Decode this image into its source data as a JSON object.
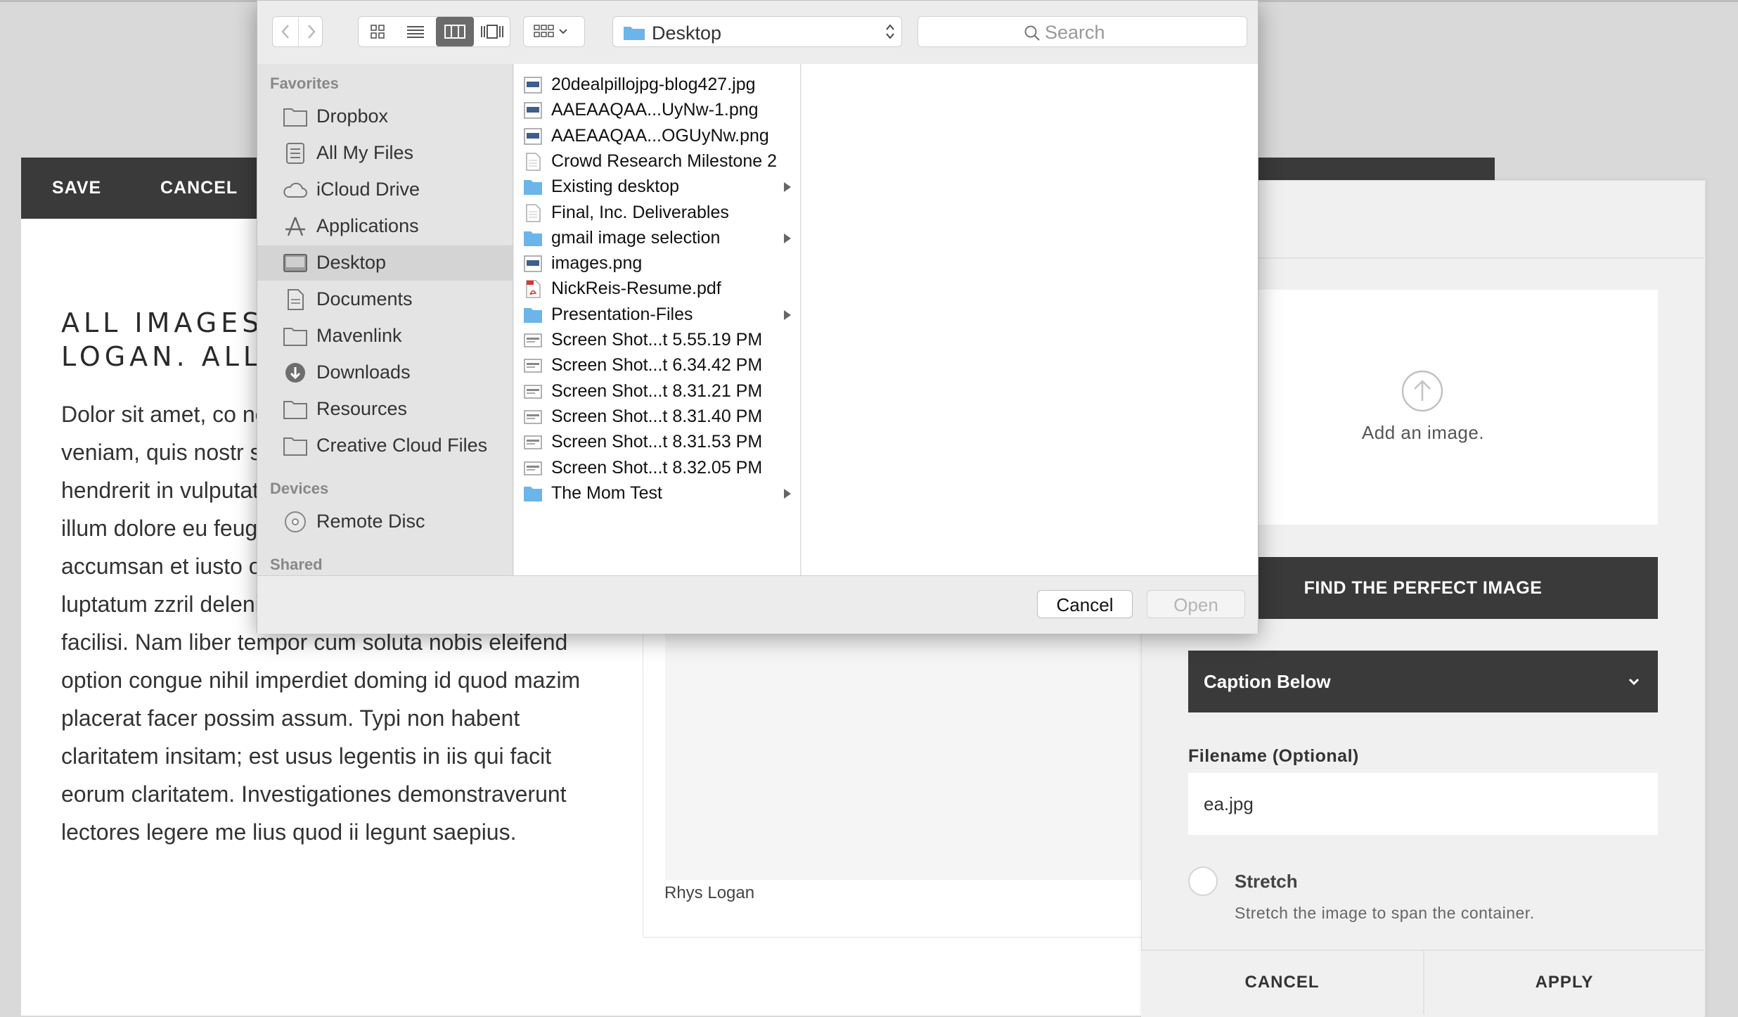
{
  "editor": {
    "save_label": "SAVE",
    "cancel_label": "CANCEL",
    "heading": "ALL IMAGES\nLOGAN. ALL",
    "body": "Dolor sit amet, co nonummy nibh eu magna aliquam er veniam, quis nostr suscipit lobortis n consequat. Duis a hendrerit in vulputate velit esse molestie consequat, vel illum dolore eu feugiat nulla facilisis at vero eros et accumsan et iusto odio dignissim qui blandit praesent luptatum zzril delenit augue duis dolore te feugait nulla facilisi. Nam liber tempor cum soluta nobis eleifend option congue nihil imperdiet doming id quod mazim placerat facer possim assum. Typi non habent claritatem insitam; est usus legentis in iis qui facit eorum claritatem. Investigationes demonstraverunt lectores legere me lius quod ii legunt saepius.",
    "image_caption": "Rhys Logan"
  },
  "panel": {
    "dropzone_text": "Add an image.",
    "dropzone_icon": "upload-arrow-icon",
    "find_button": "FIND THE PERFECT IMAGE",
    "caption_value": "Caption Below",
    "filename_label": "Filename (Optional)",
    "filename_value": "ea.jpg",
    "stretch_label": "Stretch",
    "stretch_desc": "Stretch the image to span the container.",
    "cancel_label": "CANCEL",
    "apply_label": "APPLY"
  },
  "dialog": {
    "location": "Desktop",
    "search_placeholder": "Search",
    "sidebar_sections": {
      "favorites": "Favorites",
      "devices": "Devices",
      "shared": "Shared"
    },
    "favorites": [
      {
        "label": "Dropbox",
        "icon": "folder-icon"
      },
      {
        "label": "All My Files",
        "icon": "all-files-icon"
      },
      {
        "label": "iCloud Drive",
        "icon": "cloud-icon"
      },
      {
        "label": "Applications",
        "icon": "applications-icon"
      },
      {
        "label": "Desktop",
        "icon": "desktop-icon",
        "selected": true
      },
      {
        "label": "Documents",
        "icon": "documents-icon"
      },
      {
        "label": "Mavenlink",
        "icon": "folder-icon"
      },
      {
        "label": "Downloads",
        "icon": "downloads-icon"
      },
      {
        "label": "Resources",
        "icon": "folder-icon"
      },
      {
        "label": "Creative Cloud Files",
        "icon": "folder-icon"
      }
    ],
    "devices": [
      {
        "label": "Remote Disc",
        "icon": "disc-icon"
      }
    ],
    "files": [
      {
        "name": "20dealpillojpg-blog427.jpg",
        "kind": "image",
        "folder": false
      },
      {
        "name": "AAEAAQAA...UyNw-1.png",
        "kind": "image",
        "folder": false
      },
      {
        "name": "AAEAAQAA...OGUyNw.png",
        "kind": "image",
        "folder": false
      },
      {
        "name": "Crowd Research Milestone 2",
        "kind": "document",
        "folder": false
      },
      {
        "name": "Existing desktop",
        "kind": "folder",
        "folder": true
      },
      {
        "name": "Final, Inc. Deliverables",
        "kind": "document",
        "folder": false
      },
      {
        "name": "gmail image selection",
        "kind": "folder",
        "folder": true
      },
      {
        "name": "images.png",
        "kind": "image",
        "folder": false
      },
      {
        "name": "NickReis-Resume.pdf",
        "kind": "pdf",
        "folder": false
      },
      {
        "name": "Presentation-Files",
        "kind": "folder",
        "folder": true
      },
      {
        "name": "Screen Shot...t 5.55.19 PM",
        "kind": "screenshot",
        "folder": false
      },
      {
        "name": "Screen Shot...t 6.34.42 PM",
        "kind": "screenshot",
        "folder": false
      },
      {
        "name": "Screen Shot...t 8.31.21 PM",
        "kind": "screenshot",
        "folder": false
      },
      {
        "name": "Screen Shot...t 8.31.40 PM",
        "kind": "screenshot",
        "folder": false
      },
      {
        "name": "Screen Shot...t 8.31.53 PM",
        "kind": "screenshot",
        "folder": false
      },
      {
        "name": "Screen Shot...t 8.32.05 PM",
        "kind": "screenshot",
        "folder": false
      },
      {
        "name": "The Mom Test",
        "kind": "folder",
        "folder": true
      }
    ],
    "cancel_label": "Cancel",
    "open_label": "Open"
  },
  "colors": {
    "dark_bar": "#3a3a3a",
    "folder_blue": "#6bb5ea",
    "sidebar_bg": "#e4e4e4"
  }
}
